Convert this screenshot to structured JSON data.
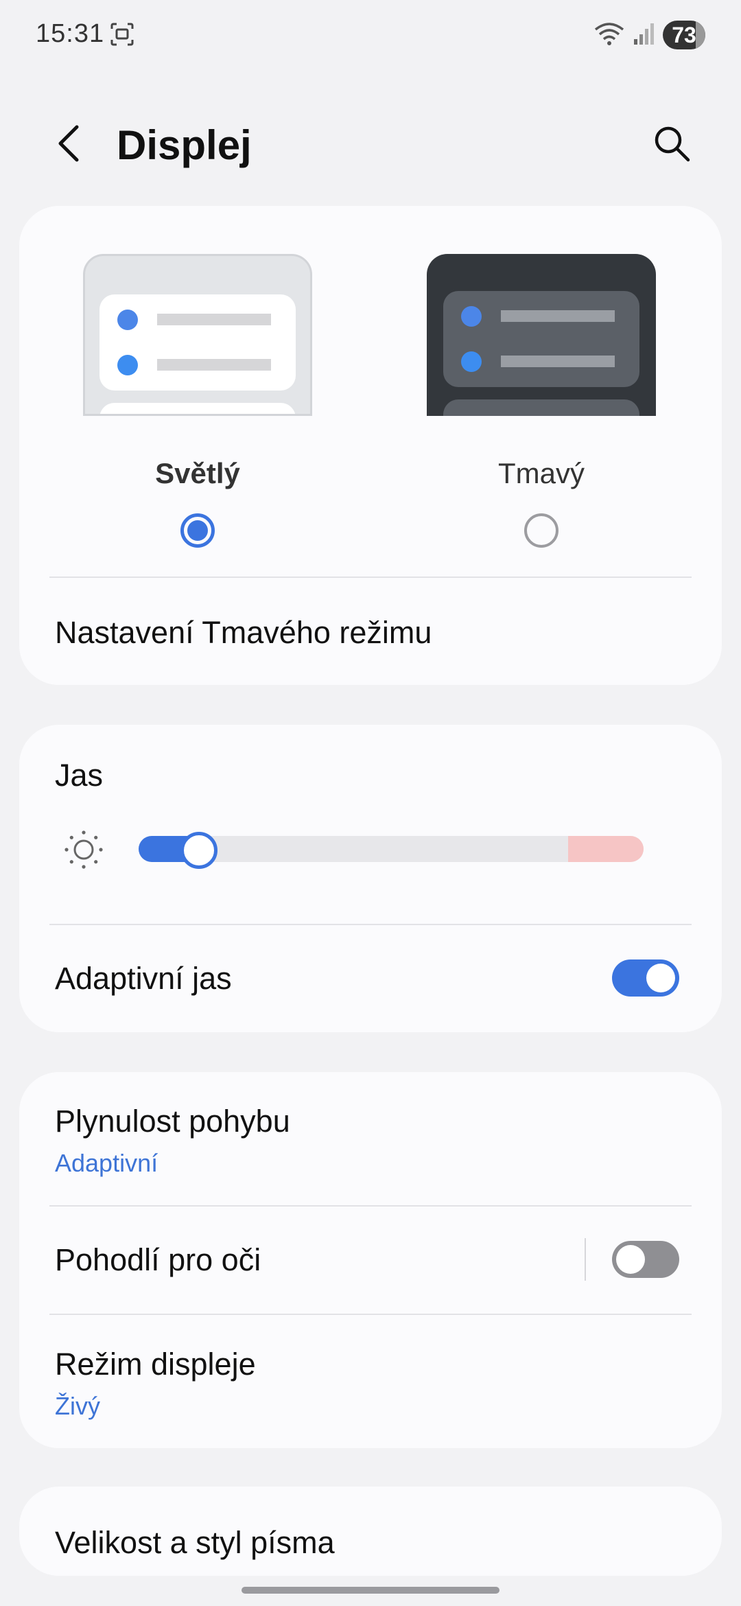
{
  "status_bar": {
    "time": "15:31",
    "battery": "73",
    "icons": [
      "screenshot-icon",
      "wifi-icon",
      "signal-icon"
    ]
  },
  "header": {
    "title": "Displej",
    "back_icon": "back-arrow-icon",
    "search_icon": "search-icon"
  },
  "theme": {
    "options": [
      {
        "label": "Světlý",
        "selected": true
      },
      {
        "label": "Tmavý",
        "selected": false
      }
    ],
    "dark_mode_settings": "Nastavení Tmavého režimu"
  },
  "brightness": {
    "label": "Jas",
    "level": 0.12,
    "extra_brightness_start": 0.85,
    "adaptive_label": "Adaptivní jas",
    "adaptive_on": true
  },
  "display": {
    "motion_smoothness": {
      "label": "Plynulost pohybu",
      "value": "Adaptivní"
    },
    "eye_comfort": {
      "label": "Pohodlí pro oči",
      "on": false
    },
    "screen_mode": {
      "label": "Režim displeje",
      "value": "Živý"
    }
  },
  "font": {
    "label": "Velikost a styl písma"
  },
  "colors": {
    "accent": "#3b74df",
    "background": "#f2f2f4",
    "card": "#fbfbfd",
    "subtext": "#3e74d6"
  }
}
